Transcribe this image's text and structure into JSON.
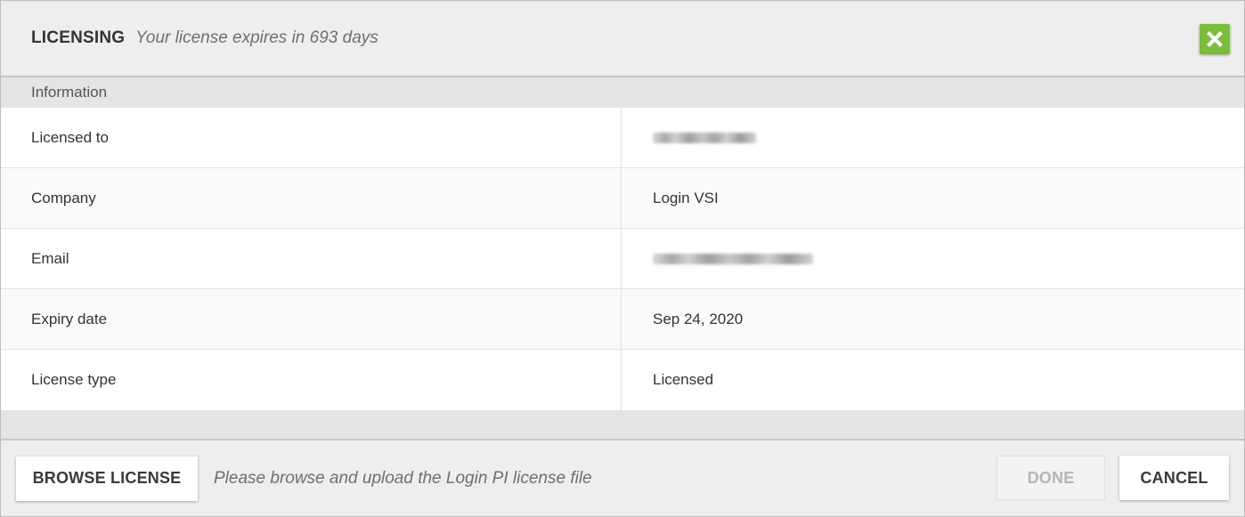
{
  "header": {
    "title": "LICENSING",
    "subtitle": "Your license expires in 693 days",
    "close_icon": "close-x-icon",
    "accent_color": "#79bd3a"
  },
  "section": {
    "title": "Information"
  },
  "rows": [
    {
      "label": "Licensed to",
      "value": "",
      "redacted": true
    },
    {
      "label": "Company",
      "value": "Login VSI",
      "redacted": false
    },
    {
      "label": "Email",
      "value": "",
      "redacted": true
    },
    {
      "label": "Expiry date",
      "value": "Sep 24, 2020",
      "redacted": false
    },
    {
      "label": "License type",
      "value": "Licensed",
      "redacted": false
    }
  ],
  "footer": {
    "browse_label": "BROWSE LICENSE",
    "hint": "Please browse and upload the Login PI license file",
    "done_label": "DONE",
    "done_disabled": true,
    "cancel_label": "CANCEL"
  }
}
